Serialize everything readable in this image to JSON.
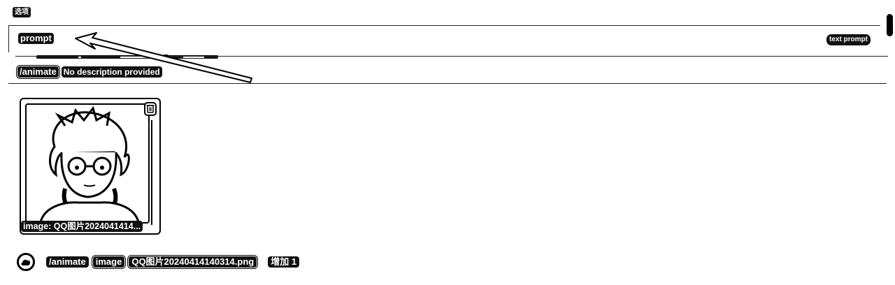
{
  "options_label": "选项",
  "option": {
    "name": "prompt",
    "type_badge": "text prompt"
  },
  "command": {
    "name": "/animate",
    "description": "No description provided"
  },
  "attachment": {
    "caption": "image: QQ图片2024041414..."
  },
  "chat_input": {
    "command": "/animate",
    "param_label": "image",
    "param_value": "QQ图片20240414140314.png",
    "add_label": "增加 1"
  },
  "icons": {
    "attach": "cloud-upload-icon",
    "remove": "trash-icon",
    "annotation": "arrow-annotation-icon"
  },
  "colors": {
    "ink": "#000000",
    "background": "#ffffff"
  }
}
